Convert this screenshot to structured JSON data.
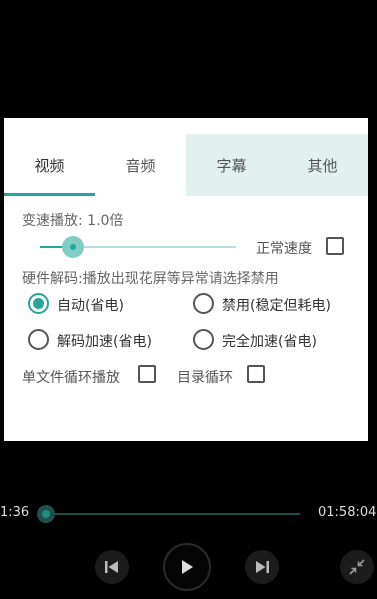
{
  "dialog": {
    "tabs": [
      {
        "label": "视频"
      },
      {
        "label": "音频"
      },
      {
        "label": "字幕"
      },
      {
        "label": "其他"
      }
    ],
    "speed_label": "变速播放: 1.0倍",
    "speed_value": 1.0,
    "normal_speed_label": "正常速度",
    "hw_decode_label": "硬件解码:播放出现花屏等异常请选择禁用",
    "decode_options": [
      {
        "label": "自动(省电)"
      },
      {
        "label": "禁用(稳定但耗电)"
      },
      {
        "label": "解码加速(省电)"
      },
      {
        "label": "完全加速(省电)"
      }
    ],
    "selected_decode_option": "自动(省电)",
    "single_loop_label": "单文件循环播放",
    "dir_loop_label": "目录循环"
  },
  "player": {
    "current_time": "1:36",
    "total_time": "01:58:04"
  },
  "colors": {
    "accent": "#26a69a",
    "tab_bg": "#e2f1ef"
  }
}
